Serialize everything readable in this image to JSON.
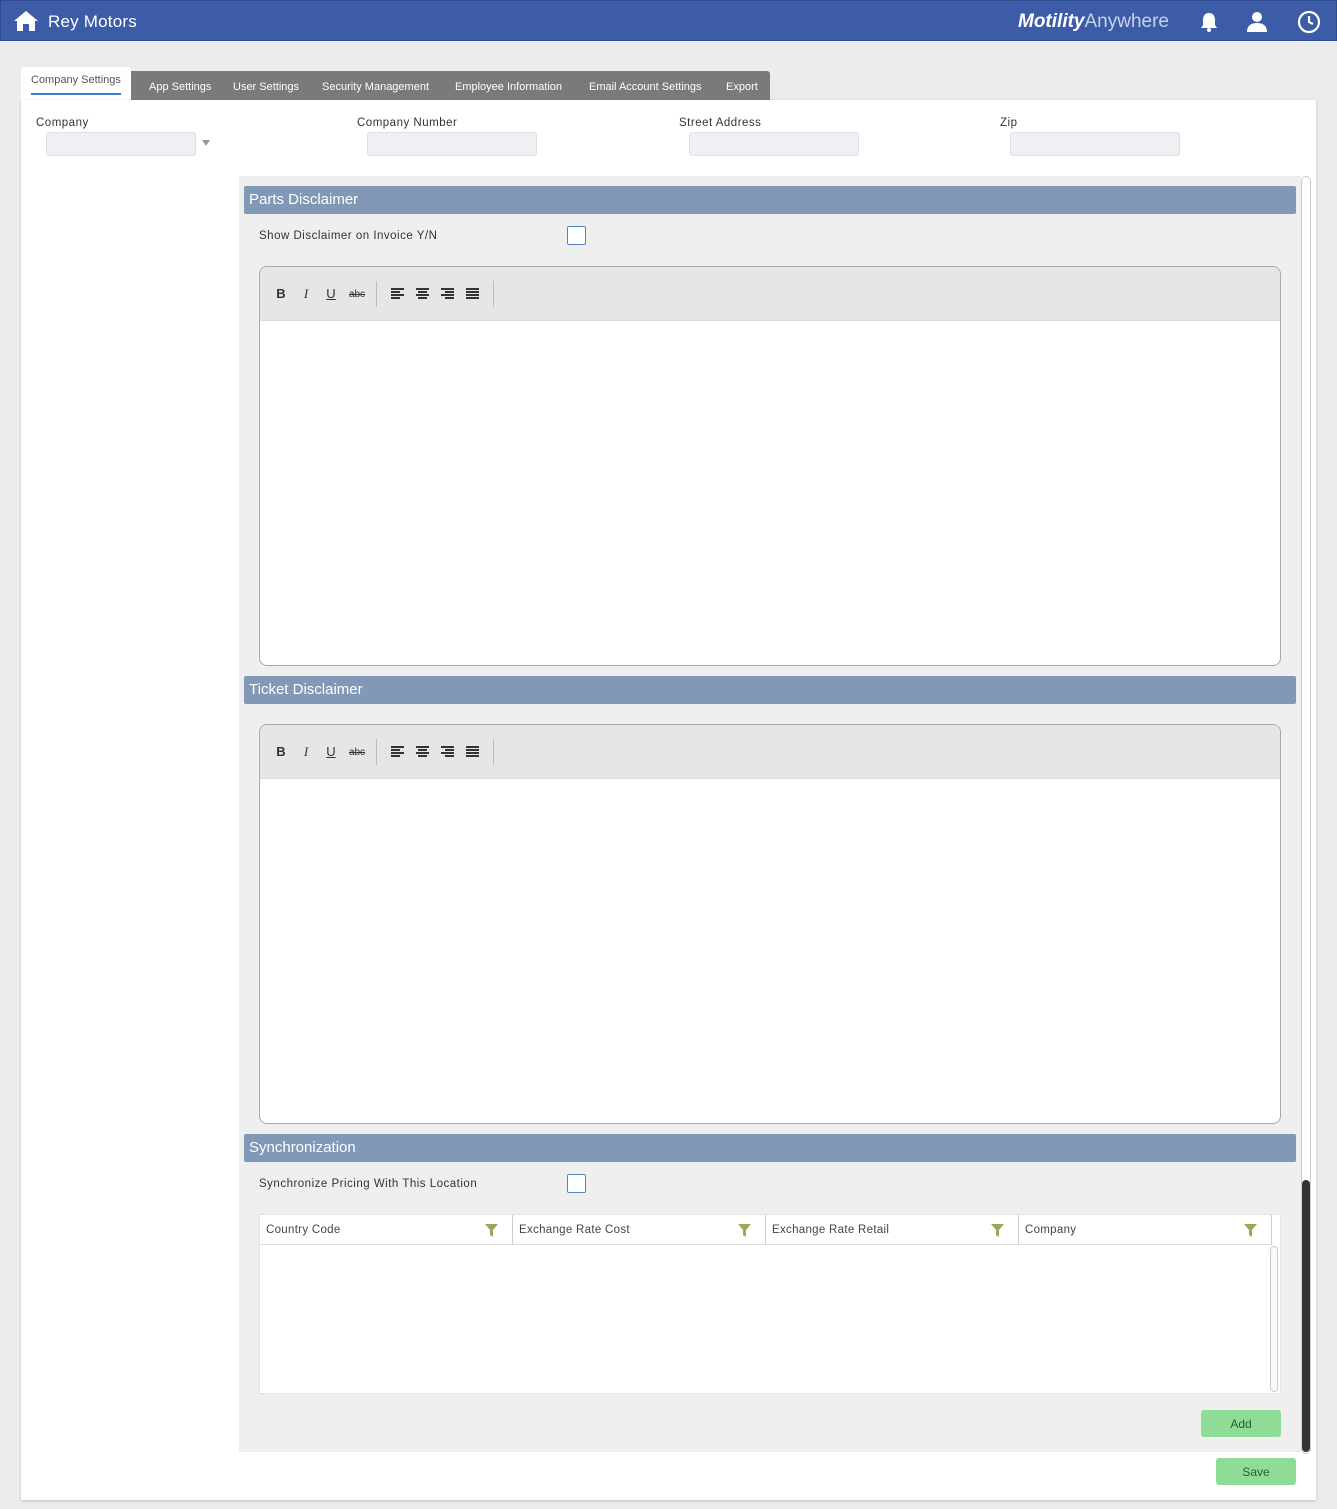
{
  "header": {
    "app_title": "Rey Motors",
    "brand_bold": "Motility",
    "brand_light": "Anywhere",
    "icons": [
      "home-icon",
      "bell-icon",
      "user-icon",
      "clock-icon"
    ],
    "bar_color": "#3d5ca8"
  },
  "tabs": [
    {
      "label": "Company Settings",
      "active": true
    },
    {
      "label": "App Settings"
    },
    {
      "label": "User Settings"
    },
    {
      "label": "Security Management"
    },
    {
      "label": "Employee Information"
    },
    {
      "label": "Email Account Settings"
    },
    {
      "label": "Export"
    }
  ],
  "fields": {
    "company": {
      "label": "Company",
      "value": ""
    },
    "company_number": {
      "label": "Company Number",
      "value": ""
    },
    "street_address": {
      "label": "Street Address",
      "value": ""
    },
    "zip": {
      "label": "Zip",
      "value": ""
    }
  },
  "parts_disclaimer": {
    "title": "Parts Disclaimer",
    "checkbox_label": "Show Disclaimer on Invoice Y/N",
    "checked": false
  },
  "ticket_disclaimer": {
    "title": "Ticket Disclaimer"
  },
  "editor_toolbar": {
    "bold": "B",
    "italic": "I",
    "underline": "U",
    "strike": "abc"
  },
  "synchronization": {
    "title": "Synchronization",
    "checkbox_label": "Synchronize Pricing With This Location",
    "checked": false,
    "columns": [
      "Country Code",
      "Exchange Rate Cost",
      "Exchange Rate Retail",
      "Company"
    ],
    "add_label": "Add"
  },
  "save_label": "Save",
  "colors": {
    "section_bar": "#8199b6",
    "button_green": "#8fdc96",
    "accent": "#3d7bd9"
  }
}
